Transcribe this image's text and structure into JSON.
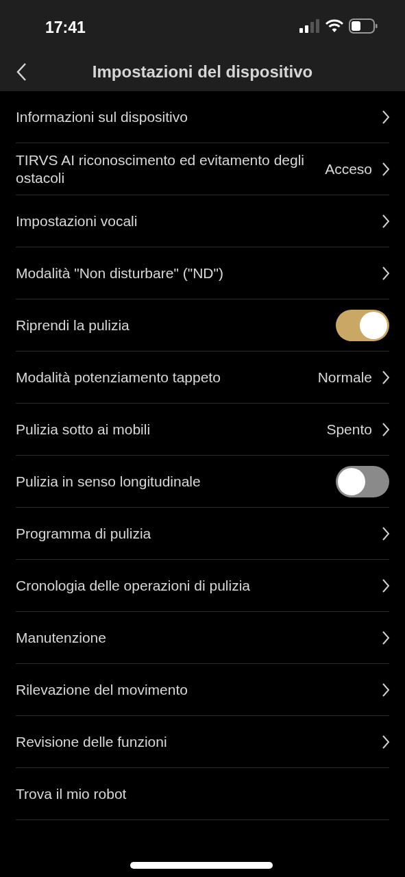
{
  "status_bar": {
    "time": "17:41"
  },
  "nav": {
    "title": "Impostazioni del dispositivo"
  },
  "rows": [
    {
      "kind": "link",
      "label": "Informazioni sul dispositivo"
    },
    {
      "kind": "link",
      "label": "TIRVS AI riconoscimento ed evitamento degli ostacoli",
      "value": "Acceso"
    },
    {
      "kind": "link",
      "label": "Impostazioni vocali"
    },
    {
      "kind": "link",
      "label": "Modalità \"Non disturbare\" (\"ND\")"
    },
    {
      "kind": "toggle",
      "label": "Riprendi la pulizia",
      "on": true
    },
    {
      "kind": "link",
      "label": "Modalità potenziamento tappeto",
      "value": "Normale"
    },
    {
      "kind": "link",
      "label": "Pulizia sotto ai mobili",
      "value": "Spento"
    },
    {
      "kind": "toggle",
      "label": "Pulizia in senso longitudinale",
      "on": false
    },
    {
      "kind": "link",
      "label": "Programma di pulizia"
    },
    {
      "kind": "link",
      "label": "Cronologia delle operazioni di pulizia"
    },
    {
      "kind": "link",
      "label": "Manutenzione"
    },
    {
      "kind": "link",
      "label": "Rilevazione del movimento"
    },
    {
      "kind": "link",
      "label": "Revisione delle funzioni"
    },
    {
      "kind": "plain",
      "label": "Trova il mio robot"
    }
  ]
}
